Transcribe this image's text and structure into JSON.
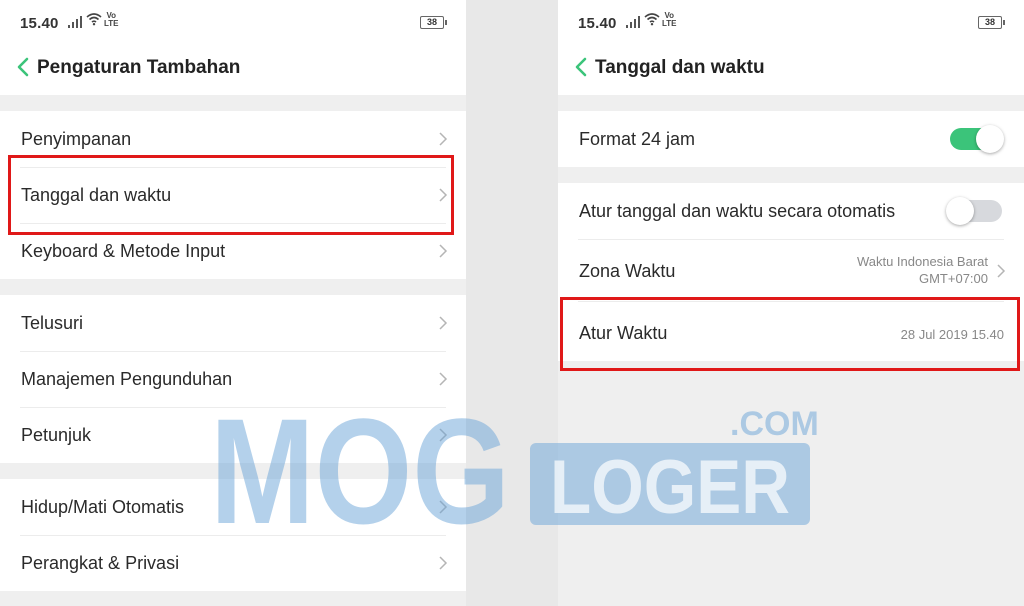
{
  "left": {
    "status": {
      "time": "15.40",
      "volte": [
        "Vo",
        "LTE"
      ],
      "battery": "38"
    },
    "title": "Pengaturan Tambahan",
    "groups": [
      [
        "Penyimpanan",
        "Tanggal dan waktu",
        "Keyboard & Metode Input"
      ],
      [
        "Telusuri",
        "Manajemen Pengunduhan",
        "Petunjuk"
      ],
      [
        "Hidup/Mati Otomatis",
        "Perangkat & Privasi"
      ]
    ]
  },
  "right": {
    "status": {
      "time": "15.40",
      "volte": [
        "Vo",
        "LTE"
      ],
      "battery": "38"
    },
    "title": "Tanggal dan waktu",
    "format24": {
      "label": "Format 24 jam",
      "enabled": true
    },
    "auto_time": {
      "label": "Atur tanggal dan waktu secara otomatis",
      "enabled": false
    },
    "timezone": {
      "label": "Zona Waktu",
      "value_line1": "Waktu Indonesia Barat",
      "value_line2": "GMT+07:00"
    },
    "set_time": {
      "label": "Atur Waktu",
      "value": "28 Jul 2019  15.40"
    }
  },
  "watermark": {
    "text1": "MOG",
    "text2": "LOGER",
    "text3": ".COM"
  },
  "colors": {
    "accent": "#3bc47a",
    "highlight": "#e01818",
    "watermark": "#6aa3d8"
  }
}
